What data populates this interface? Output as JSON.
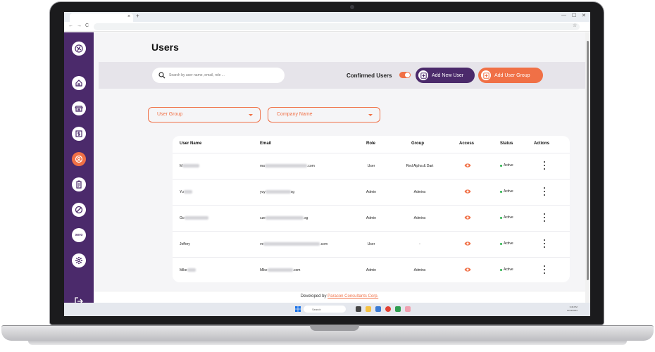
{
  "browser": {
    "tab_close": "×",
    "tab_new": "+",
    "nav_back": "←",
    "nav_forward": "→",
    "nav_reload": "C",
    "bookmark_icon": "☆",
    "win_min": "—",
    "win_max": "☐",
    "win_close": "✕"
  },
  "sidebar": {
    "items": [
      {
        "icon": "home-icon",
        "active": false
      },
      {
        "icon": "store-icon",
        "active": false
      },
      {
        "icon": "dollar-icon",
        "active": false
      },
      {
        "icon": "user-circle-icon",
        "active": true
      },
      {
        "icon": "clipboard-icon",
        "active": false
      },
      {
        "icon": "block-icon",
        "active": false
      },
      {
        "icon": "xero-icon",
        "active": false,
        "text": "xero"
      },
      {
        "icon": "settings-icon",
        "active": false
      }
    ],
    "logout_icon": "logout-icon"
  },
  "page": {
    "title": "Users"
  },
  "toolbar": {
    "search_placeholder": "Search by user name, email, role ...",
    "confirmed_label": "Confirmed Users",
    "confirmed_on": true,
    "add_user_label": "Add New User",
    "add_group_label": "Add User Group"
  },
  "filters": {
    "user_group": "User Group",
    "company_name": "Company Name"
  },
  "table": {
    "headers": {
      "user_name": "User Name",
      "email": "Email",
      "role": "Role",
      "group": "Group",
      "access": "Access",
      "status": "Status",
      "actions": "Actions"
    },
    "rows": [
      {
        "name": "M",
        "email_start": "ma",
        "email_end": ".com",
        "role": "User",
        "group": "Red Alpha & Dart",
        "status": "Active"
      },
      {
        "name": "Yu",
        "email_start": "yuy",
        "email_end": "sg",
        "role": "Admin",
        "group": "Admins",
        "status": "Active"
      },
      {
        "name": "Go",
        "email_start": "cze",
        "email_end": ".sg",
        "role": "Admin",
        "group": "Admins",
        "status": "Active"
      },
      {
        "name": "Joffery",
        "email_start": "ve",
        "email_end": ".com",
        "role": "User",
        "group": "-",
        "status": "Active"
      },
      {
        "name": "Mike",
        "email_start": "Mike",
        "email_end": ".com",
        "role": "Admin",
        "group": "Admins",
        "status": "Active"
      }
    ]
  },
  "footer": {
    "prefix": "Developed by",
    "link": "Paracon Consultants Corp."
  },
  "taskbar": {
    "search": "Search",
    "time": "3:46 PM",
    "date": "11/12/2024"
  },
  "colors": {
    "brand_purple": "#4b2a6b",
    "accent_orange": "#f07046",
    "status_green": "#2ab14b"
  }
}
